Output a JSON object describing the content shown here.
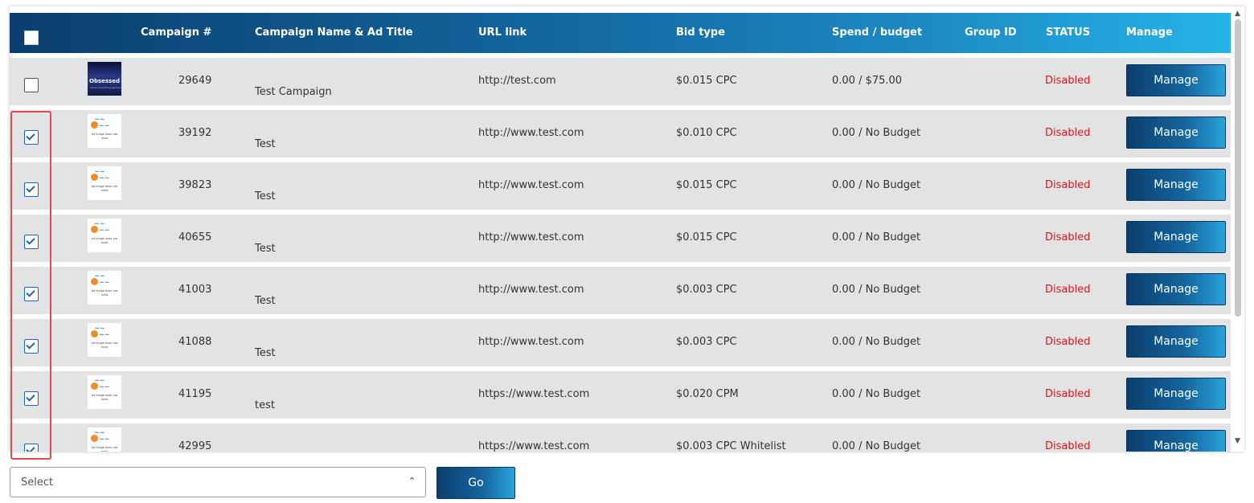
{
  "table": {
    "headers": {
      "campaign_num": "Campaign #",
      "name": "Campaign Name & Ad Title",
      "url": "URL link",
      "bid": "Bid type",
      "spend": "Spend / budget",
      "group": "Group ID",
      "status": "STATUS",
      "manage": "Manage"
    },
    "rows": [
      {
        "checked": false,
        "thumb": "obsessed",
        "thumb_text": "Obsessed",
        "thumb_sub": "about everything gaming",
        "num": "29649",
        "name": "Test Campaign",
        "url": "http://test.com",
        "bid": "$0.015 CPC",
        "spend": "0.00 / $75.00",
        "status": "Disabled",
        "manage": "Manage"
      },
      {
        "checked": true,
        "thumb": "placeholder",
        "thumb_text": "ad image does not exist",
        "num": "39192",
        "name": "Test",
        "url": "http://www.test.com",
        "bid": "$0.010 CPC",
        "spend": "0.00 / No Budget",
        "status": "Disabled",
        "manage": "Manage"
      },
      {
        "checked": true,
        "thumb": "placeholder",
        "thumb_text": "ad image does not exist",
        "num": "39823",
        "name": "Test",
        "url": "http://www.test.com",
        "bid": "$0.015 CPC",
        "spend": "0.00 / No Budget",
        "status": "Disabled",
        "manage": "Manage"
      },
      {
        "checked": true,
        "thumb": "placeholder",
        "thumb_text": "ad image does not exist",
        "num": "40655",
        "name": "Test",
        "url": "http://www.test.com",
        "bid": "$0.015 CPC",
        "spend": "0.00 / No Budget",
        "status": "Disabled",
        "manage": "Manage"
      },
      {
        "checked": true,
        "thumb": "placeholder",
        "thumb_text": "ad image does not exist",
        "num": "41003",
        "name": "Test",
        "url": "http://www.test.com",
        "bid": "$0.003 CPC",
        "spend": "0.00 / No Budget",
        "status": "Disabled",
        "manage": "Manage"
      },
      {
        "checked": true,
        "thumb": "placeholder",
        "thumb_text": "ad image does not exist",
        "num": "41088",
        "name": "Test",
        "url": "http://www.test.com",
        "bid": "$0.003 CPC",
        "spend": "0.00 / No Budget",
        "status": "Disabled",
        "manage": "Manage"
      },
      {
        "checked": true,
        "thumb": "placeholder",
        "thumb_text": "ad image does not exist",
        "num": "41195",
        "name": "test",
        "url": "https://www.test.com",
        "bid": "$0.020 CPM",
        "spend": "0.00 / No Budget",
        "status": "Disabled",
        "manage": "Manage"
      },
      {
        "checked": true,
        "thumb": "placeholder",
        "thumb_text": "ad image does not exist",
        "num": "42995",
        "name": "",
        "url": "https://www.test.com",
        "bid": "$0.003 CPC Whitelist",
        "spend": "0.00 / No Budget",
        "status": "Disabled",
        "manage": "Manage"
      }
    ]
  },
  "bulk_action": {
    "select_value": "Select",
    "go_label": "Go"
  },
  "colors": {
    "status_disabled": "#e01515",
    "header_dark": "#0b3e6e",
    "header_light": "#25b4e8",
    "highlight": "#e04b4b"
  }
}
